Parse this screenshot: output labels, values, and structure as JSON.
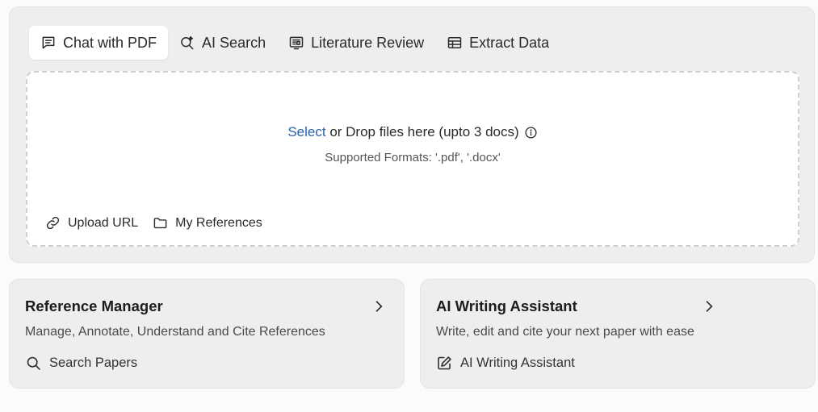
{
  "tabs": [
    {
      "label": "Chat with PDF",
      "icon": "chat-icon",
      "active": true
    },
    {
      "label": "AI Search",
      "icon": "ai-search-icon",
      "active": false
    },
    {
      "label": "Literature Review",
      "icon": "literature-review-icon",
      "active": false
    },
    {
      "label": "Extract Data",
      "icon": "table-icon",
      "active": false
    }
  ],
  "upload": {
    "select_label": "Select",
    "drop_text": " or Drop files here (upto 3 docs)",
    "info_icon": "info-icon",
    "formats_text": "Supported Formats: '.pdf', '.docx'",
    "actions": [
      {
        "label": "Upload URL",
        "icon": "link-icon"
      },
      {
        "label": "My References",
        "icon": "folder-icon"
      }
    ]
  },
  "cards": [
    {
      "title": "Reference Manager",
      "description": "Manage, Annotate, Understand and Cite References",
      "link_label": "Search Papers",
      "link_icon": "search-icon",
      "chevron_icon": "chevron-right-icon"
    },
    {
      "title": "AI Writing Assistant",
      "description": "Write, edit and cite your next paper with ease",
      "link_label": "AI Writing Assistant",
      "link_icon": "edit-icon",
      "chevron_icon": "chevron-right-icon"
    }
  ],
  "colors": {
    "link": "#2a62a8",
    "panel_bg": "#eeeeec",
    "page_bg": "#fbfbf9"
  }
}
